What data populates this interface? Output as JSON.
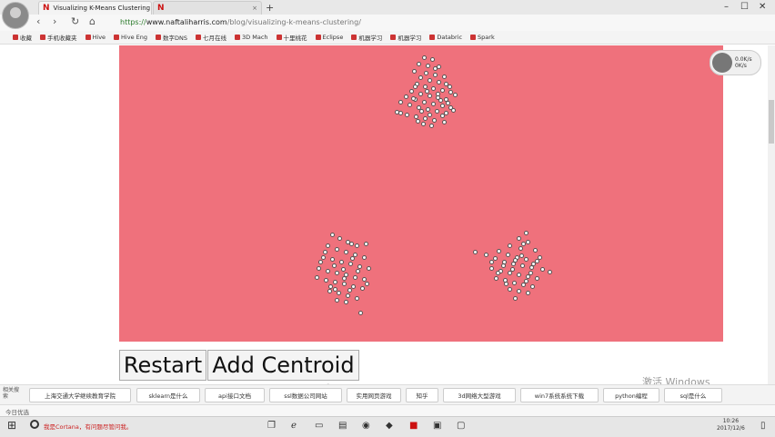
{
  "browser": {
    "tabs": [
      {
        "icon": "N",
        "title": "Visualizing K-Means Clustering",
        "active": true
      },
      {
        "icon": "N",
        "title": "",
        "active": false
      }
    ],
    "new_tab": "+",
    "window_controls": [
      "–",
      "☐",
      "✕"
    ],
    "nav": {
      "back": "‹",
      "forward": "›",
      "reload": "↻",
      "home": "⌂"
    },
    "url": {
      "scheme": "https://",
      "host": "www.naftaliharris.com",
      "path": "/blog/visualizing-k-means-clustering/"
    },
    "bookmarks": [
      "收藏",
      "手机收藏夹",
      "Hive",
      "Hive Eng",
      "数字DNS",
      "七月在线",
      "3D Mach",
      "十里桃花",
      "Eclipse",
      "机器学习",
      "机器学习",
      "Databric",
      "Spark"
    ]
  },
  "page": {
    "canvas_color": "#ef717c",
    "clusters": [
      {
        "name": "cluster-top",
        "points": [
          [
            466,
            63
          ],
          [
            475,
            65
          ],
          [
            460,
            70
          ],
          [
            470,
            72
          ],
          [
            482,
            73
          ],
          [
            455,
            78
          ],
          [
            468,
            80
          ],
          [
            478,
            82
          ],
          [
            488,
            84
          ],
          [
            462,
            85
          ],
          [
            472,
            88
          ],
          [
            482,
            90
          ],
          [
            490,
            92
          ],
          [
            458,
            92
          ],
          [
            467,
            95
          ],
          [
            476,
            97
          ],
          [
            486,
            99
          ],
          [
            495,
            101
          ],
          [
            452,
            100
          ],
          [
            462,
            103
          ],
          [
            472,
            105
          ],
          [
            481,
            107
          ],
          [
            490,
            109
          ],
          [
            446,
            106
          ],
          [
            456,
            109
          ],
          [
            466,
            112
          ],
          [
            476,
            114
          ],
          [
            486,
            116
          ],
          [
            495,
            118
          ],
          [
            440,
            112
          ],
          [
            450,
            115
          ],
          [
            460,
            118
          ],
          [
            470,
            120
          ],
          [
            480,
            122
          ],
          [
            490,
            124
          ],
          [
            436,
            123
          ],
          [
            447,
            126
          ],
          [
            457,
            128
          ],
          [
            467,
            130
          ],
          [
            477,
            132
          ],
          [
            488,
            134
          ],
          [
            465,
            136
          ],
          [
            474,
            138
          ],
          [
            484,
            110
          ],
          [
            494,
            95
          ],
          [
            500,
            104
          ],
          [
            498,
            121
          ],
          [
            456,
            95
          ],
          [
            463,
            122
          ],
          [
            472,
            126
          ],
          [
            481,
            103
          ],
          [
            440,
            124
          ],
          [
            478,
            75
          ],
          [
            454,
            108
          ],
          [
            469,
            100
          ],
          [
            486,
            127
          ],
          [
            459,
            133
          ],
          [
            492,
            113
          ]
        ]
      },
      {
        "name": "cluster-bottom-left",
        "points": [
          [
            365,
            258
          ],
          [
            373,
            262
          ],
          [
            382,
            266
          ],
          [
            392,
            270
          ],
          [
            402,
            268
          ],
          [
            360,
            270
          ],
          [
            370,
            274
          ],
          [
            380,
            277
          ],
          [
            390,
            280
          ],
          [
            400,
            283
          ],
          [
            355,
            283
          ],
          [
            365,
            285
          ],
          [
            375,
            288
          ],
          [
            385,
            290
          ],
          [
            395,
            293
          ],
          [
            405,
            295
          ],
          [
            350,
            295
          ],
          [
            360,
            298
          ],
          [
            370,
            300
          ],
          [
            380,
            302
          ],
          [
            390,
            305
          ],
          [
            400,
            307
          ],
          [
            348,
            305
          ],
          [
            358,
            308
          ],
          [
            368,
            310
          ],
          [
            378,
            312
          ],
          [
            388,
            315
          ],
          [
            398,
            317
          ],
          [
            362,
            320
          ],
          [
            372,
            322
          ],
          [
            382,
            325
          ],
          [
            392,
            328
          ],
          [
            370,
            330
          ],
          [
            380,
            332
          ],
          [
            396,
            344
          ],
          [
            387,
            284
          ],
          [
            377,
            296
          ],
          [
            367,
            292
          ],
          [
            357,
            277
          ],
          [
            403,
            312
          ],
          [
            363,
            315
          ],
          [
            386,
            268
          ],
          [
            378,
            306
          ],
          [
            368,
            318
          ],
          [
            393,
            298
          ],
          [
            352,
            288
          ],
          [
            384,
            319
          ]
        ]
      },
      {
        "name": "cluster-bottom-right",
        "points": [
          [
            578,
            256
          ],
          [
            570,
            262
          ],
          [
            580,
            266
          ],
          [
            560,
            270
          ],
          [
            572,
            273
          ],
          [
            588,
            275
          ],
          [
            548,
            276
          ],
          [
            558,
            280
          ],
          [
            568,
            283
          ],
          [
            578,
            285
          ],
          [
            590,
            287
          ],
          [
            522,
            277
          ],
          [
            534,
            280
          ],
          [
            544,
            284
          ],
          [
            554,
            288
          ],
          [
            564,
            290
          ],
          [
            574,
            292
          ],
          [
            584,
            294
          ],
          [
            596,
            296
          ],
          [
            604,
            299
          ],
          [
            540,
            295
          ],
          [
            550,
            298
          ],
          [
            560,
            300
          ],
          [
            570,
            302
          ],
          [
            580,
            304
          ],
          [
            590,
            306
          ],
          [
            545,
            306
          ],
          [
            555,
            308
          ],
          [
            565,
            311
          ],
          [
            575,
            313
          ],
          [
            585,
            315
          ],
          [
            560,
            318
          ],
          [
            570,
            320
          ],
          [
            580,
            322
          ],
          [
            566,
            328
          ],
          [
            553,
            292
          ],
          [
            563,
            296
          ],
          [
            573,
            281
          ],
          [
            583,
            300
          ],
          [
            593,
            283
          ],
          [
            540,
            288
          ],
          [
            575,
            268
          ],
          [
            556,
            312
          ],
          [
            586,
            290
          ],
          [
            547,
            300
          ],
          [
            566,
            286
          ],
          [
            578,
            309
          ]
        ]
      }
    ],
    "buttons": {
      "restart": "Restart",
      "add_centroid": "Add Centroid"
    },
    "overlay_widget": {
      "line1": "0.0K/s",
      "line2": "0K/s"
    },
    "watermark": "激活 Windows"
  },
  "related_search": {
    "label": "相关搜索",
    "items": [
      "上海交通大学继续教育学院",
      "sklearn是什么",
      "api接口文档",
      "ssl数据公司网站",
      "实用网页游戏",
      "知乎",
      "3d网络大型游戏",
      "win7系统系统下载",
      "python编程",
      "sql是什么"
    ]
  },
  "status": {
    "left": "今日优选"
  },
  "taskbar": {
    "search_text": "我是Cortana，有问题尽管问我。",
    "clock_time": "10:26",
    "clock_date": "2017/12/6"
  }
}
